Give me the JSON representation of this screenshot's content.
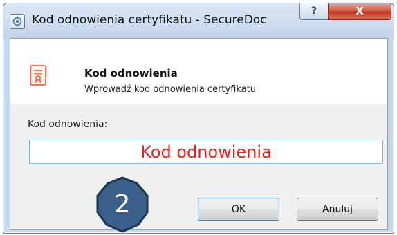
{
  "window": {
    "title": "Kod odnowienia certyfikatu - SecureDoc",
    "help_glyph": "?",
    "close_glyph": "X",
    "icons": {
      "app": "app-icon",
      "help": "help-icon",
      "close": "close-icon"
    }
  },
  "header": {
    "title": "Kod odnowienia",
    "subtitle": "Wprowadź kod odnowienia certyfikatu",
    "icon": "certificate-icon"
  },
  "form": {
    "label": "Kod odnowienia:",
    "placeholder": "Kod odnowienia",
    "value": ""
  },
  "annotation": {
    "step": "2",
    "color": "#3a5f8a"
  },
  "buttons": {
    "ok": "OK",
    "cancel": "Anuluj"
  },
  "colors": {
    "accent": "#3c7fb1",
    "placeholder_text": "#e8211c",
    "close_button": "#c13a24",
    "certificate_icon": "#f4704a"
  }
}
